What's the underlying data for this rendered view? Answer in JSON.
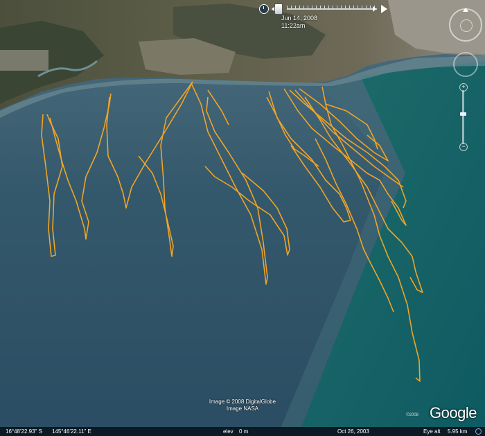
{
  "time_slider": {
    "date": "Jun 14, 2008",
    "time": "11:22am"
  },
  "imagery": {
    "line1": "Image © 2008 DigitalGlobe",
    "line2": "Image NASA"
  },
  "logo": {
    "text": "Google",
    "small": "©2008"
  },
  "status": {
    "latitude": "16°48'22.93\" S",
    "longitude": "145°46'22.11\" E",
    "elev_label": "elev",
    "elev_value": "0 m",
    "imagery_date": "Oct 26, 2003",
    "eye_label": "Eye alt",
    "eye_value": "5.95 km"
  },
  "colors": {
    "track": "#f0a428",
    "sea": "#2f5468",
    "sea_green": "#0e5b61"
  }
}
